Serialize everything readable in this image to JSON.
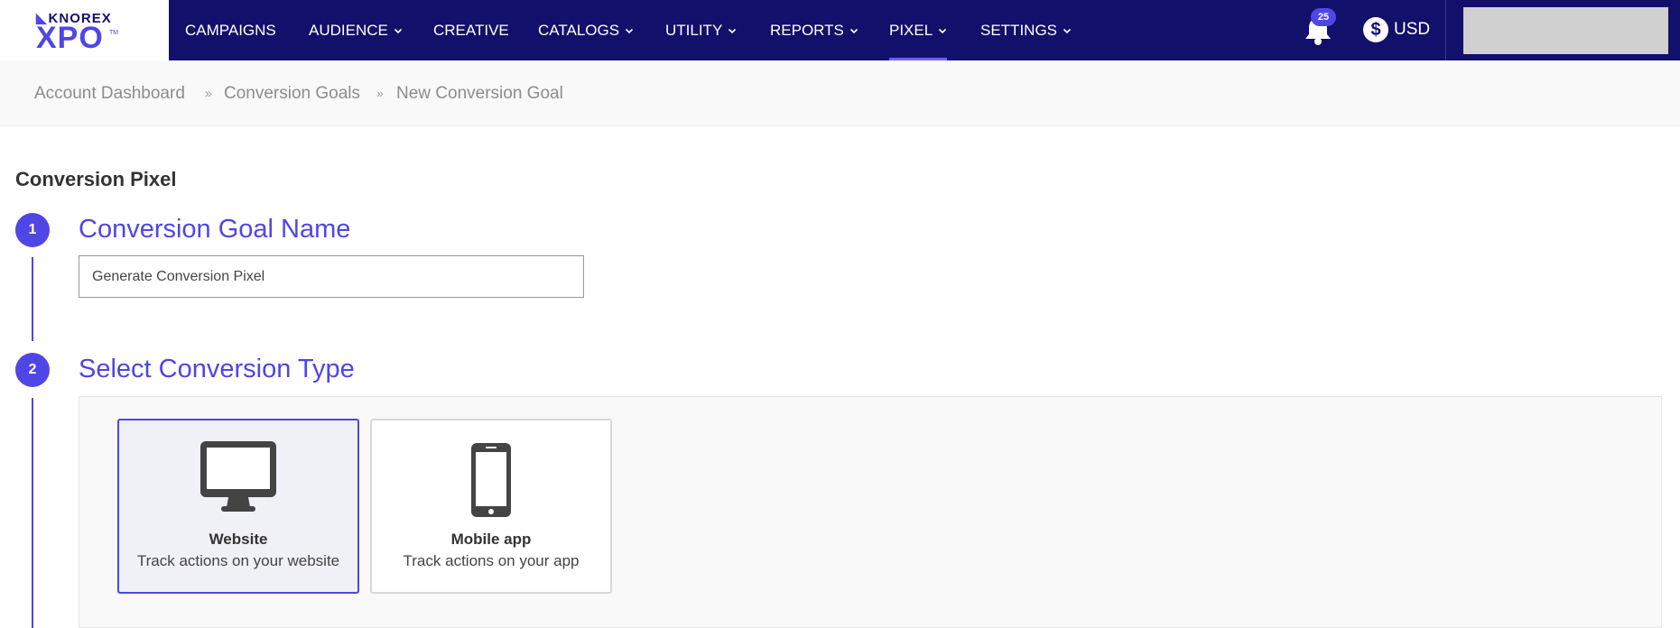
{
  "brand": {
    "top": "KNOREX",
    "main": "XPO",
    "tm": "TM"
  },
  "nav": {
    "items": [
      {
        "label": "CAMPAIGNS",
        "dropdown": false,
        "active": false
      },
      {
        "label": "AUDIENCE",
        "dropdown": true,
        "active": false
      },
      {
        "label": "CREATIVE",
        "dropdown": false,
        "active": false
      },
      {
        "label": "CATALOGS",
        "dropdown": true,
        "active": false
      },
      {
        "label": "UTILITY",
        "dropdown": true,
        "active": false
      },
      {
        "label": "REPORTS",
        "dropdown": true,
        "active": false
      },
      {
        "label": "PIXEL",
        "dropdown": true,
        "active": true
      },
      {
        "label": "SETTINGS",
        "dropdown": true,
        "active": false
      }
    ],
    "notifications_count": "25",
    "currency": "USD",
    "currency_symbol": "$"
  },
  "breadcrumb": {
    "items": [
      "Account Dashboard",
      "Conversion Goals",
      "New Conversion Goal"
    ],
    "separator": "»"
  },
  "main": {
    "section_title": "Conversion Pixel",
    "step1": {
      "number": "1",
      "title": "Conversion Goal Name",
      "input_value": "Generate Conversion Pixel"
    },
    "step2": {
      "number": "2",
      "title": "Select Conversion Type",
      "options": [
        {
          "title": "Website",
          "description": "Track actions on your website",
          "icon": "desktop-icon",
          "selected": true
        },
        {
          "title": "Mobile app",
          "description": "Track actions on your app",
          "icon": "mobile-phone-icon",
          "selected": false
        }
      ]
    }
  },
  "colors": {
    "nav_bg": "#13106b",
    "accent": "#4f46e5",
    "account_placeholder": "#d0d0d0"
  }
}
